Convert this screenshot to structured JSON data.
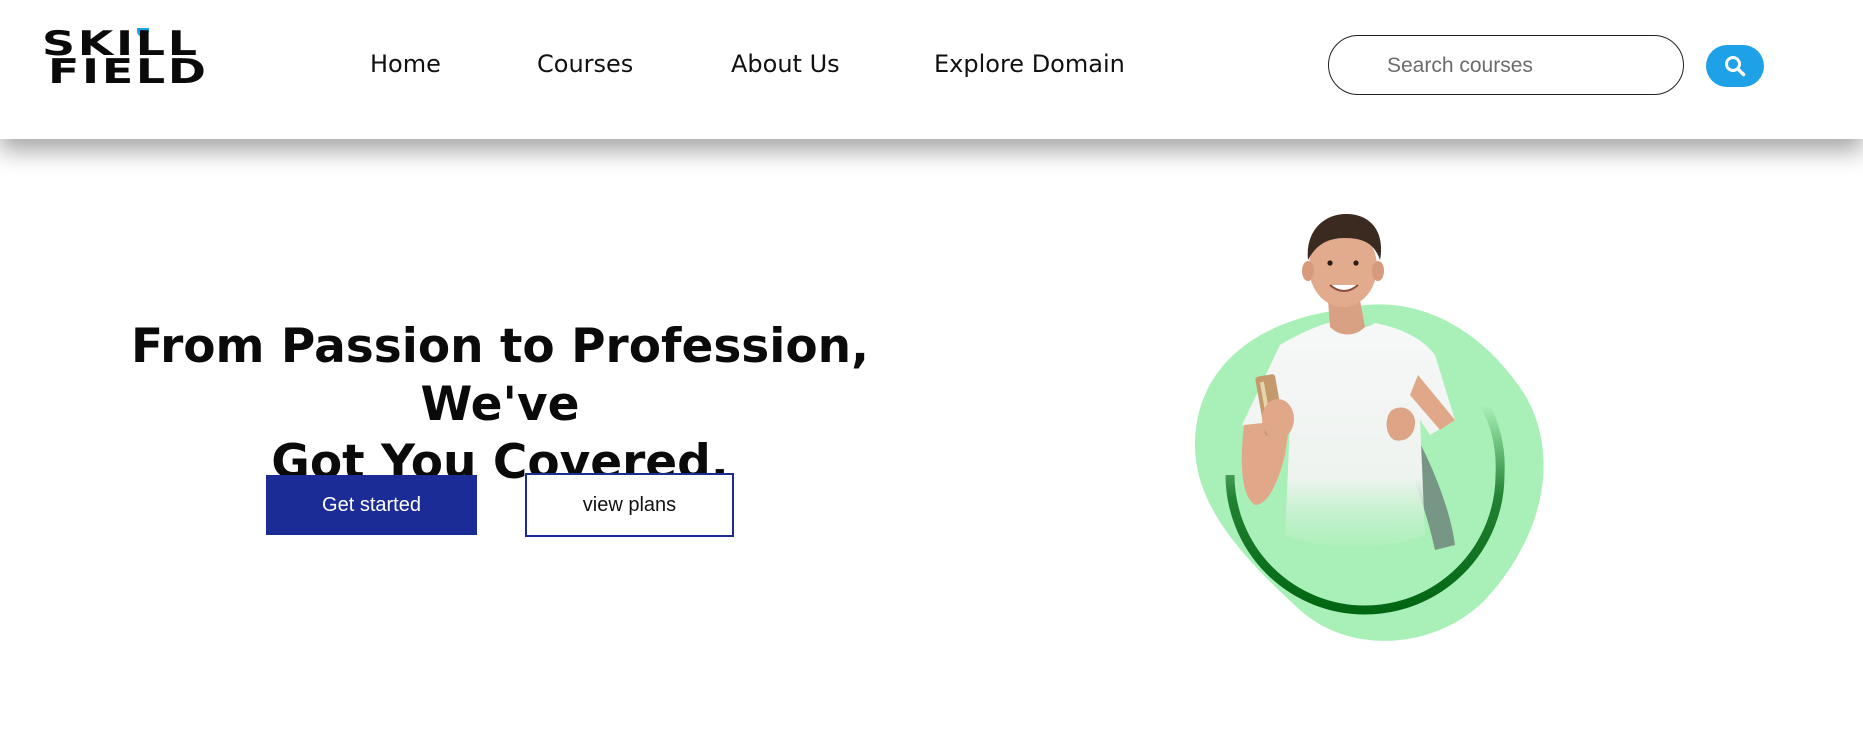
{
  "header": {
    "logo": {
      "line1": "SKILL",
      "line2": "FIELD",
      "accent_color": "#1ea1e6"
    },
    "nav": [
      {
        "label": "Home"
      },
      {
        "label": "Courses"
      },
      {
        "label": "About Us"
      },
      {
        "label": "Explore Domain"
      }
    ],
    "search": {
      "placeholder": "Search courses",
      "value": "",
      "button_icon": "search-icon",
      "button_color": "#1ea1e6"
    }
  },
  "hero": {
    "title_line1": "From Passion to Profession, We've",
    "title_line2": "Got You Covered.",
    "primary_button": "Get started",
    "secondary_button": "view plans",
    "primary_color": "#1c2c97",
    "illustration": {
      "icon": "student-with-backpack-illustration",
      "blob_color": "#a9f0b8",
      "ring_color": "#006611"
    }
  }
}
